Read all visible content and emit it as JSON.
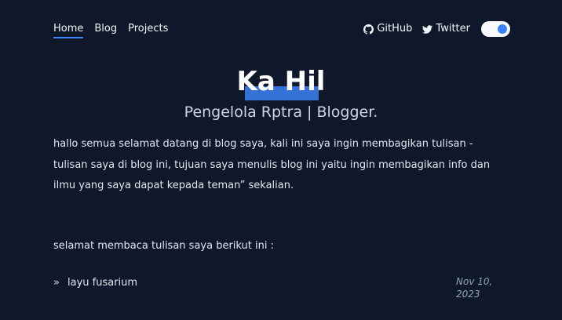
{
  "nav": {
    "links": [
      {
        "label": "Home",
        "active": true
      },
      {
        "label": "Blog",
        "active": false
      },
      {
        "label": "Projects",
        "active": false
      }
    ],
    "github_label": "GitHub",
    "twitter_label": "Twitter",
    "theme_toggle_on": true
  },
  "hero": {
    "title": "Ka Hil",
    "subtitle": "Pengelola Rptra | Blogger."
  },
  "intro": "hallo semua selamat datang di blog saya, kali ini saya ingin membagikan tulisan - tulisan saya di blog ini, tujuan saya menulis blog ini yaitu ingin membagikan info dan ilmu yang saya dapat kepada teman” sekalian.",
  "read_note": "selamat membaca tulisan saya berikut ini :",
  "posts": [
    {
      "bullet": "»",
      "title": "layu fusarium",
      "date": "Nov 10, 2023"
    }
  ],
  "colors": {
    "background": "#0f172a",
    "accent": "#3b82f6",
    "text": "#e2e8f0",
    "muted": "#94a3b8"
  }
}
